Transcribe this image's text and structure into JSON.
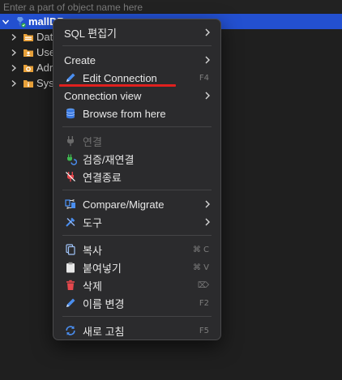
{
  "search": {
    "placeholder": "Enter a part of object name here"
  },
  "tree": {
    "root": {
      "label": "mallDB"
    },
    "children": [
      {
        "label": "Dat"
      },
      {
        "label": "Use"
      },
      {
        "label": "Adr"
      },
      {
        "label": "Sys"
      }
    ]
  },
  "menu": {
    "sql_editor": {
      "label": "SQL 편집기"
    },
    "create": {
      "label": "Create"
    },
    "edit_connection": {
      "label": "Edit Connection",
      "shortcut": "F4"
    },
    "connection_view": {
      "label": "Connection view"
    },
    "browse_from_here": {
      "label": "Browse from here"
    },
    "connect": {
      "label": "연결"
    },
    "validate_reconnect": {
      "label": "검증/재연결"
    },
    "disconnect": {
      "label": "연결종료"
    },
    "compare_migrate": {
      "label": "Compare/Migrate"
    },
    "tools": {
      "label": "도구"
    },
    "copy": {
      "label": "복사",
      "shortcut": "⌘ C"
    },
    "paste": {
      "label": "붙여넣기",
      "shortcut": "⌘ V"
    },
    "delete": {
      "label": "삭제",
      "shortcut": "⌦"
    },
    "rename": {
      "label": "이름 변경",
      "shortcut": "F2"
    },
    "refresh": {
      "label": "새로 고침",
      "shortcut": "F5"
    }
  },
  "colors": {
    "selection": "#2350d0",
    "menu_bg": "#2b2b2d",
    "highlight_underline": "#e0201e"
  }
}
